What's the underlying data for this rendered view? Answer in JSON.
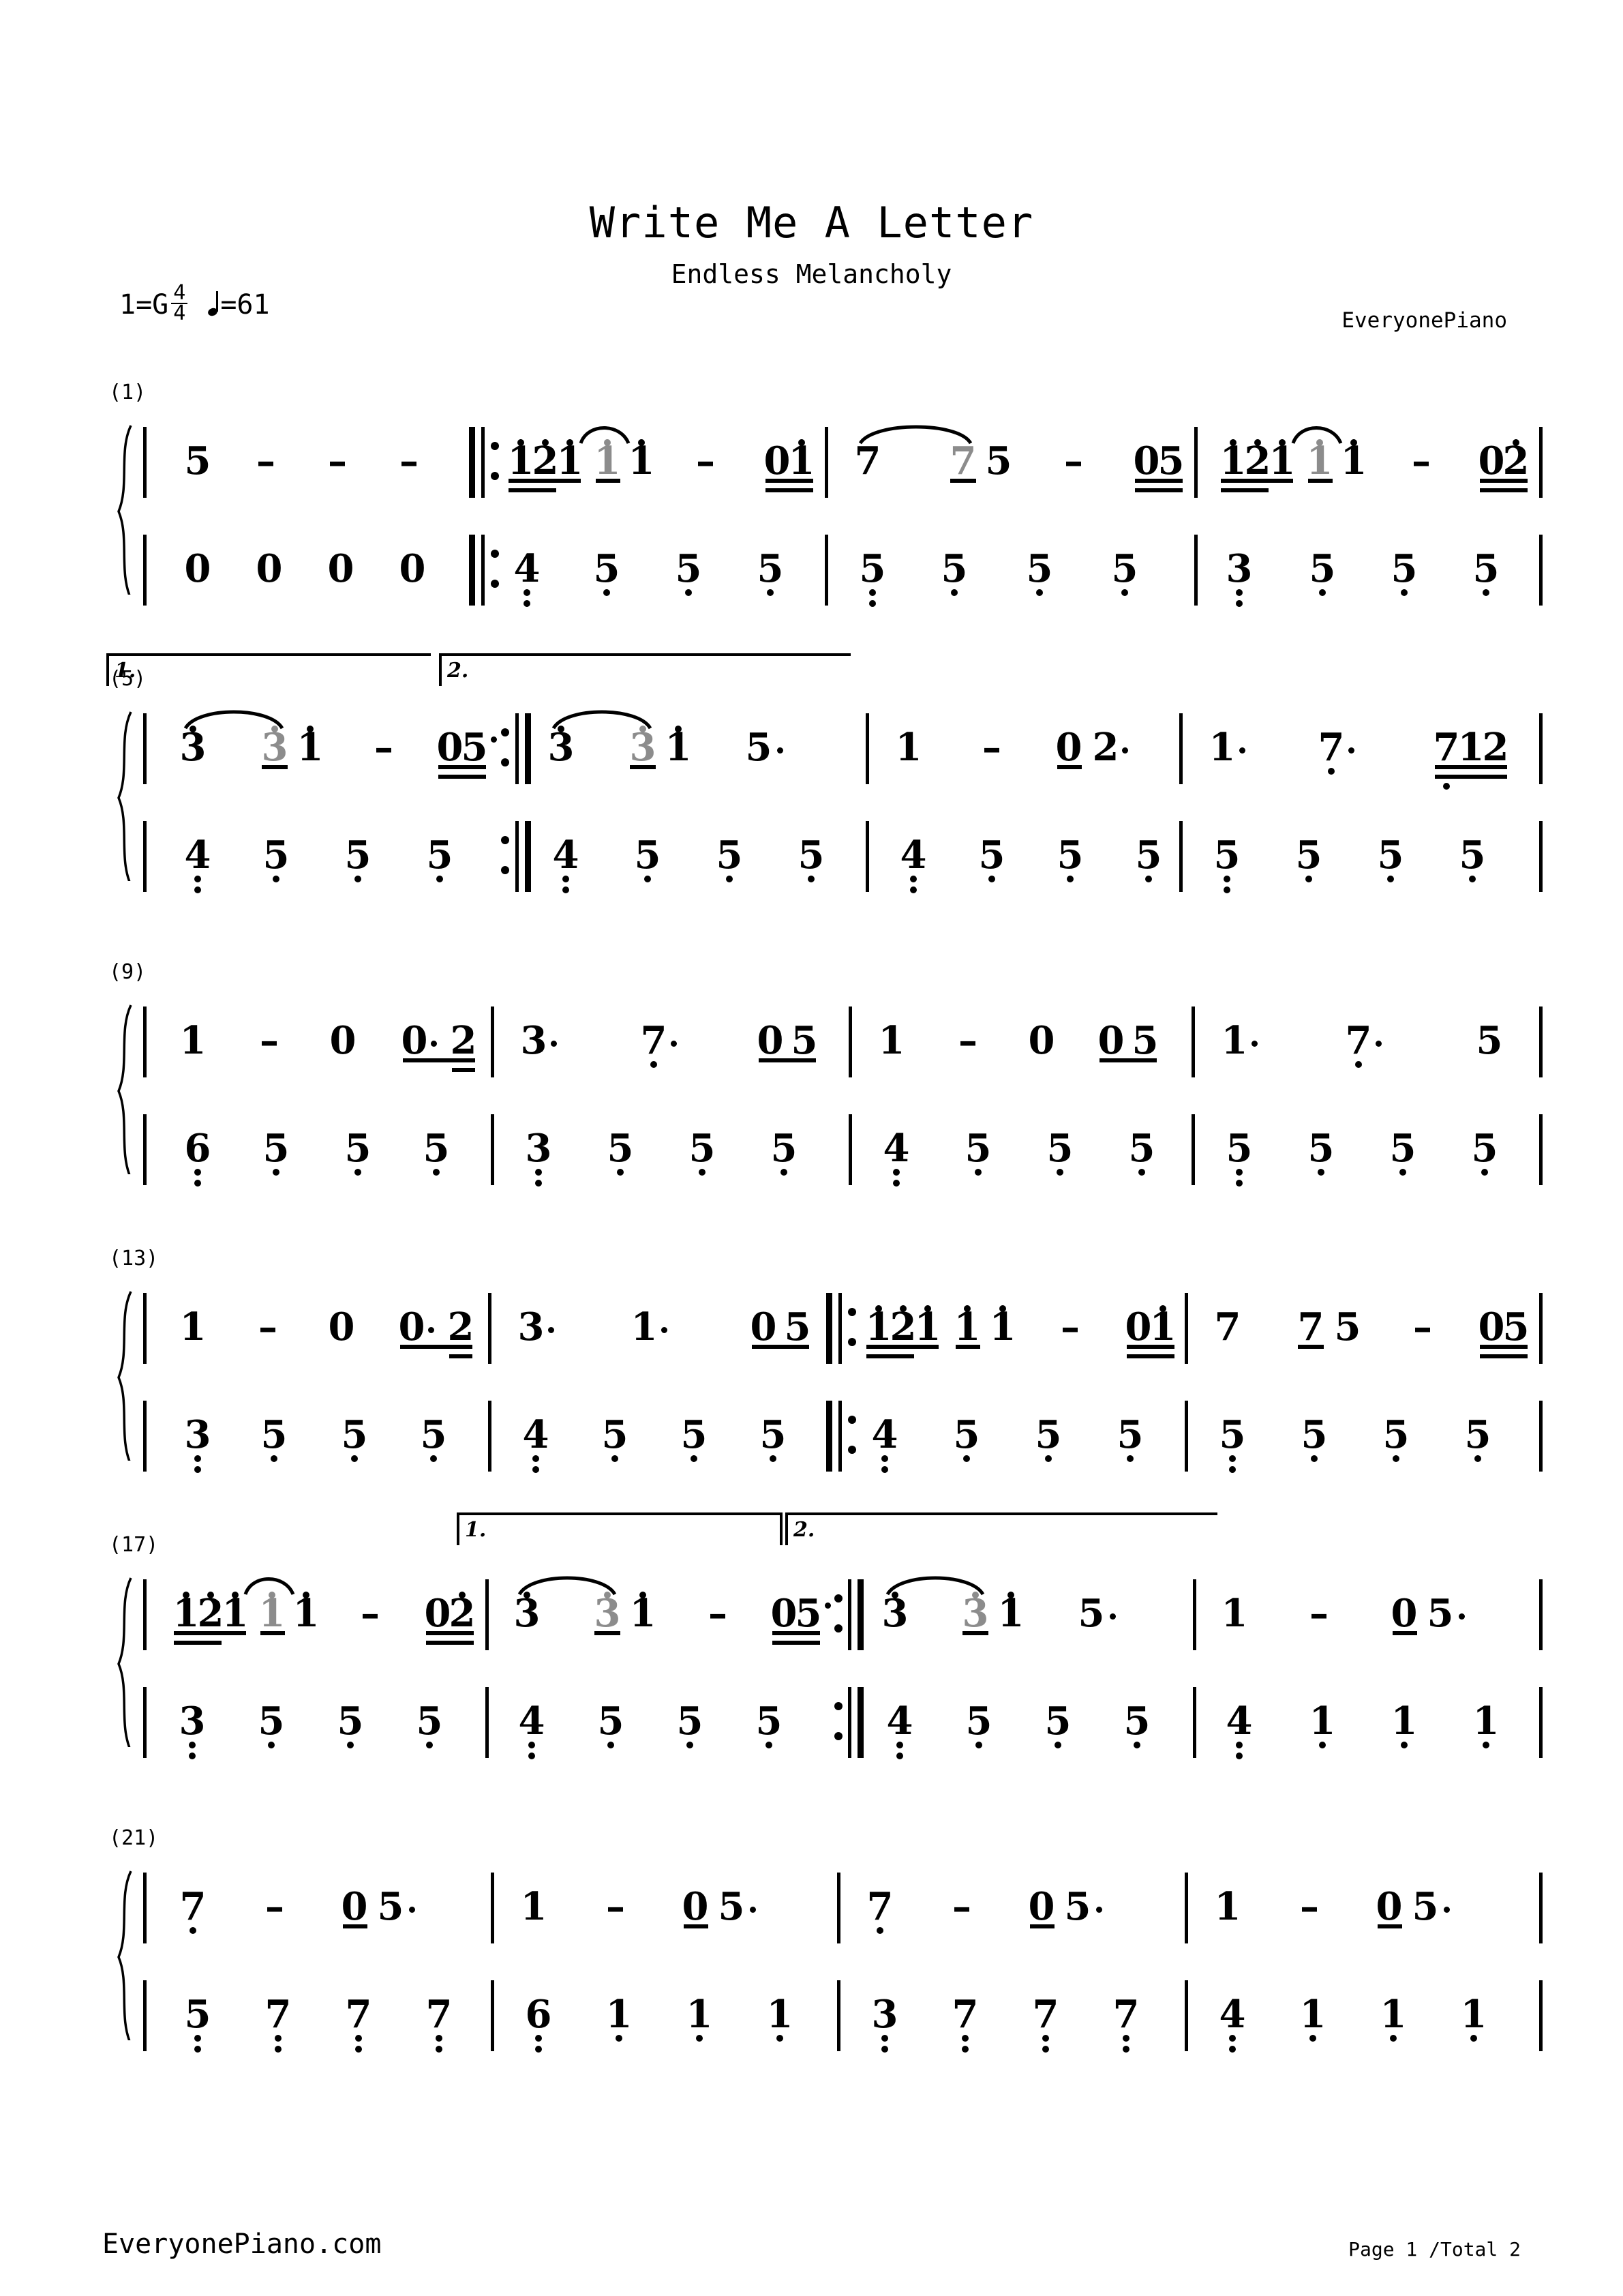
{
  "header": {
    "title": "Write Me A Letter",
    "subtitle": "Endless Melancholy",
    "key": "1=G",
    "time_num": "4",
    "time_den": "4",
    "tempo": "=61",
    "credit": "EveryonePiano"
  },
  "footer": {
    "site": "EveryonePiano.com",
    "page": "Page 1 /Total 2"
  },
  "notation": {
    "type": "jianpu",
    "systems": [
      {
        "label": "(1)",
        "measures": [
          "1",
          "2",
          "3",
          "4"
        ]
      },
      {
        "label": "(5)",
        "measures": [
          "5",
          "6",
          "7",
          "8"
        ]
      },
      {
        "label": "(9)",
        "measures": [
          "9",
          "10",
          "11",
          "12"
        ]
      },
      {
        "label": "(13)",
        "measures": [
          "13",
          "14",
          "15",
          "16"
        ]
      },
      {
        "label": "(17)",
        "measures": [
          "17",
          "18",
          "19",
          "20"
        ]
      },
      {
        "label": "(21)",
        "measures": [
          "21",
          "22",
          "23",
          "24"
        ]
      }
    ],
    "voltas": [
      {
        "system": 2,
        "label": "1."
      },
      {
        "system": 2,
        "label": "2."
      },
      {
        "system": 5,
        "label": "1."
      },
      {
        "system": 5,
        "label": "2."
      }
    ],
    "melody": {
      "m1": [
        "5",
        "-",
        "-",
        "-"
      ],
      "m2": [
        "1",
        "2",
        "1",
        "1",
        "1",
        "-",
        "0",
        "1"
      ],
      "m3": [
        "7",
        "7",
        "5",
        "-",
        "0",
        "5"
      ],
      "m4": [
        "1",
        "2",
        "1",
        "1",
        "1",
        "-",
        "0",
        "2"
      ],
      "m5": [
        "3",
        "3",
        "1",
        "-",
        "0",
        "5"
      ],
      "m6": [
        "3",
        "3",
        "1",
        "5"
      ],
      "m7": [
        "1",
        "-",
        "0",
        "2"
      ],
      "m8": [
        "1",
        "7",
        "7",
        "1",
        "2"
      ],
      "m9": [
        "1",
        "-",
        "0",
        "0",
        "2"
      ],
      "m10": [
        "3",
        "7",
        "0",
        "5"
      ],
      "m11": [
        "1",
        "-",
        "0",
        "0",
        "5"
      ],
      "m12": [
        "1",
        "7",
        "5"
      ],
      "m13": [
        "1",
        "-",
        "0",
        "0",
        "2"
      ],
      "m14": [
        "3",
        "1",
        "0",
        "5"
      ],
      "m15": [
        "1",
        "2",
        "1",
        "1",
        "1",
        "-",
        "0",
        "1"
      ],
      "m16": [
        "7",
        "7",
        "5",
        "-",
        "0",
        "5"
      ],
      "m17": [
        "1",
        "2",
        "1",
        "1",
        "1",
        "-",
        "0",
        "2"
      ],
      "m18": [
        "3",
        "3",
        "1",
        "-",
        "0",
        "5"
      ],
      "m19": [
        "3",
        "3",
        "1",
        "5"
      ],
      "m20": [
        "1",
        "-",
        "0",
        "5"
      ],
      "m21": [
        "7",
        "-",
        "0",
        "5"
      ],
      "m22": [
        "1",
        "-",
        "0",
        "5"
      ],
      "m23": [
        "7",
        "-",
        "0",
        "5"
      ],
      "m24": [
        "1",
        "-",
        "0",
        "5"
      ]
    },
    "bass": {
      "m1": [
        "0",
        "0",
        "0",
        "0"
      ],
      "m2": [
        "4",
        "5",
        "5",
        "5"
      ],
      "m3": [
        "5",
        "5",
        "5",
        "5"
      ],
      "m4": [
        "3",
        "5",
        "5",
        "5"
      ],
      "m5": [
        "4",
        "5",
        "5",
        "5"
      ],
      "m6": [
        "4",
        "5",
        "5",
        "5"
      ],
      "m7": [
        "4",
        "5",
        "5",
        "5"
      ],
      "m8": [
        "5",
        "5",
        "5",
        "5"
      ],
      "m9": [
        "6",
        "5",
        "5",
        "5"
      ],
      "m10": [
        "3",
        "5",
        "5",
        "5"
      ],
      "m11": [
        "4",
        "5",
        "5",
        "5"
      ],
      "m12": [
        "5",
        "5",
        "5",
        "5"
      ],
      "m13": [
        "3",
        "5",
        "5",
        "5"
      ],
      "m14": [
        "4",
        "5",
        "5",
        "5"
      ],
      "m15": [
        "4",
        "5",
        "5",
        "5"
      ],
      "m16": [
        "5",
        "5",
        "5",
        "5"
      ],
      "m17": [
        "3",
        "5",
        "5",
        "5"
      ],
      "m18": [
        "4",
        "5",
        "5",
        "5"
      ],
      "m19": [
        "4",
        "5",
        "5",
        "5"
      ],
      "m20": [
        "4",
        "1",
        "1",
        "1"
      ],
      "m21": [
        "5",
        "7",
        "7",
        "7"
      ],
      "m22": [
        "6",
        "1",
        "1",
        "1"
      ],
      "m23": [
        "3",
        "7",
        "7",
        "7"
      ],
      "m24": [
        "4",
        "1",
        "1",
        "1"
      ]
    }
  }
}
